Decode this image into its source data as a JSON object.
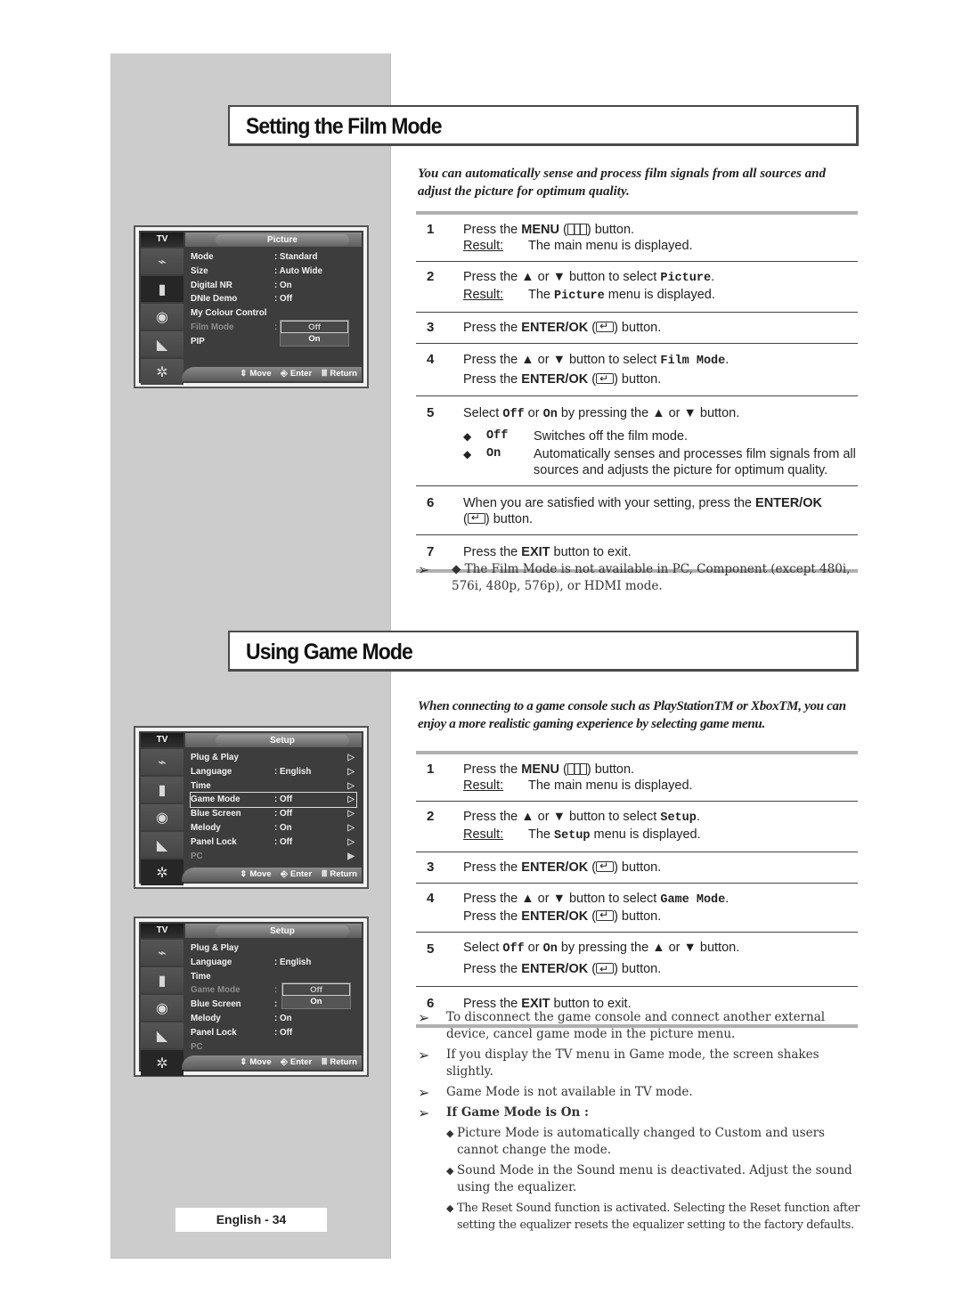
{
  "film_mode": {
    "title": "Setting the Film Mode",
    "intro": "You can automatically sense and process film signals from all sources and adjust the picture for optimum quality.",
    "osd": {
      "tv_label": "TV",
      "menu_title": "Picture",
      "rows": [
        {
          "label": "Mode",
          "value": ": Standard"
        },
        {
          "label": "Size",
          "value": ": Auto Wide"
        },
        {
          "label": "Digital NR",
          "value": ": On"
        },
        {
          "label": "DNIe Demo",
          "value": ": Off"
        },
        {
          "label": "My Colour Control",
          "value": ""
        },
        {
          "label": "Film Mode",
          "value": ":"
        },
        {
          "label": "PIP",
          "value": ""
        }
      ],
      "dropdown": [
        "Off",
        "On"
      ],
      "footer": {
        "move": "Move",
        "enter": "Enter",
        "return": "Return"
      }
    },
    "steps": [
      {
        "num": "1",
        "a": "Press the ",
        "b": "MENU",
        "c": " button.",
        "result_label": "Result:",
        "result": "The main menu is displayed."
      },
      {
        "num": "2",
        "a": "Press the ▲ or ▼ button to select ",
        "code": "Picture",
        "c": ".",
        "result_label": "Result:",
        "result_a": "The ",
        "result_code": "Picture",
        "result_b": " menu is displayed."
      },
      {
        "num": "3",
        "a": "Press the ",
        "b": "ENTER/OK",
        "c": " button."
      },
      {
        "num": "4",
        "a": "Press the ▲ or ▼ button to select ",
        "code": "Film Mode",
        "c": ".",
        "line2_a": "Press the ",
        "line2_b": "ENTER/OK",
        "line2_c": " button."
      },
      {
        "num": "5",
        "a": "Select ",
        "code1": "Off",
        "mid": " or ",
        "code2": "On",
        "c": " by pressing the ▲ or ▼ button.",
        "options": [
          {
            "key": "Off",
            "desc": "Switches off the film mode."
          },
          {
            "key": "On",
            "desc": "Automatically senses and processes film signals from all sources and adjusts the picture for optimum quality."
          }
        ]
      },
      {
        "num": "6",
        "a": "When you are satisfied with your setting, press the ",
        "b": "ENTER/OK",
        "c": " button."
      },
      {
        "num": "7",
        "a": "Press the ",
        "b": "EXIT",
        "c": " button to exit."
      }
    ],
    "note": "◆ The Film Mode is not available in PC, Component (except 480i, 576i, 480p, 576p), or HDMI mode."
  },
  "game_mode": {
    "title": "Using Game Mode",
    "intro": "When connecting to a game console such as PlayStationTM or XboxTM, you can enjoy a more realistic gaming experience by selecting game menu.",
    "osd1": {
      "tv_label": "TV",
      "menu_title": "Setup",
      "rows": [
        {
          "label": "Plug & Play",
          "value": ""
        },
        {
          "label": "Language",
          "value": ": English"
        },
        {
          "label": "Time",
          "value": ""
        },
        {
          "label": "Game Mode",
          "value": ": Off"
        },
        {
          "label": "Blue Screen",
          "value": ": Off"
        },
        {
          "label": "Melody",
          "value": ": On"
        },
        {
          "label": "Panel Lock",
          "value": ": Off"
        },
        {
          "label": "PC",
          "value": ""
        }
      ],
      "footer": {
        "move": "Move",
        "enter": "Enter",
        "return": "Return"
      }
    },
    "osd2": {
      "tv_label": "TV",
      "menu_title": "Setup",
      "rows": [
        {
          "label": "Plug & Play",
          "value": ""
        },
        {
          "label": "Language",
          "value": ": English"
        },
        {
          "label": "Time",
          "value": ""
        },
        {
          "label": "Game Mode",
          "value": ":"
        },
        {
          "label": "Blue Screen",
          "value": ":"
        },
        {
          "label": "Melody",
          "value": ": On"
        },
        {
          "label": "Panel Lock",
          "value": ": Off"
        },
        {
          "label": "PC",
          "value": ""
        }
      ],
      "dropdown": [
        "Off",
        "On"
      ],
      "footer": {
        "move": "Move",
        "enter": "Enter",
        "return": "Return"
      }
    },
    "steps": [
      {
        "num": "1",
        "a": "Press the ",
        "b": "MENU",
        "c": " button.",
        "result_label": "Result:",
        "result": "The main menu is displayed."
      },
      {
        "num": "2",
        "a": "Press the ▲ or ▼ button to select ",
        "code": "Setup",
        "c": ".",
        "result_label": "Result:",
        "result_a": "The ",
        "result_code": "Setup",
        "result_b": " menu is displayed."
      },
      {
        "num": "3",
        "a": "Press the ",
        "b": "ENTER/OK",
        "c": " button."
      },
      {
        "num": "4",
        "a": "Press the ▲ or ▼ button to select ",
        "code": "Game Mode",
        "c": ".",
        "line2_a": "Press the ",
        "line2_b": "ENTER/OK",
        "line2_c": " button."
      },
      {
        "num": "5",
        "a": "Select ",
        "code1": "Off",
        "mid": " or ",
        "code2": "On",
        "c": "  by pressing the ▲ or ▼ button.",
        "line2_a": "Press the ",
        "line2_b": "ENTER/OK",
        "line2_c": " button."
      },
      {
        "num": "6",
        "a": "Press the ",
        "b": "EXIT",
        "c": " button to exit."
      }
    ],
    "notes": [
      "To disconnect the game console and connect another external device, cancel game mode in the picture menu.",
      "If you display the TV menu in Game mode, the screen shakes slightly.",
      "Game Mode is not available in TV mode.",
      "If Game Mode is On :"
    ],
    "subnotes": [
      "Picture Mode is automatically changed to Custom and users cannot change the mode.",
      "Sound Mode in the Sound menu is deactivated. Adjust the sound using the equalizer.",
      "The Reset Sound function is activated. Selecting the Reset function after setting the equalizer resets the equalizer setting to the factory defaults."
    ]
  },
  "page_label": "English - 34",
  "icons": {
    "note_arrow": "➢",
    "diamond": "◆",
    "chevron": "▷",
    "chevron_filled": "▶",
    "move": "⇕"
  }
}
